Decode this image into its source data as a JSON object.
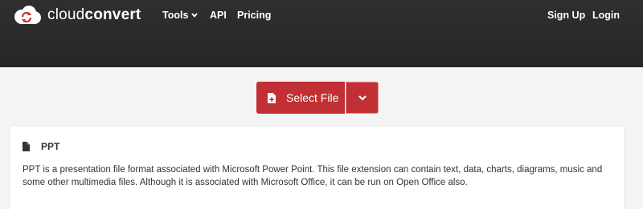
{
  "header": {
    "logo": {
      "text_light": "cloud",
      "text_bold": "convert",
      "icon": "cloudconvert-logo-icon"
    },
    "nav": {
      "tools": "Tools",
      "api": "API",
      "pricing": "Pricing",
      "sign_up": "Sign Up",
      "login": "Login"
    }
  },
  "converter": {
    "select_file_label": "Select File",
    "select_file_icon": "file-plus-icon",
    "dropdown_icon": "chevron-down-icon"
  },
  "format_info": {
    "icon": "document-icon",
    "title": "PPT",
    "description": "PPT is a presentation file format associated with Microsoft Power Point. This file extension can contain text, data, charts, diagrams, music and some other multimedia files. Although it is associated with Microsoft Office, it can be run on Open Office also."
  },
  "colors": {
    "header_bg": "#2a2a2a",
    "accent": "#c13034",
    "page_bg": "#f4f4f4"
  }
}
